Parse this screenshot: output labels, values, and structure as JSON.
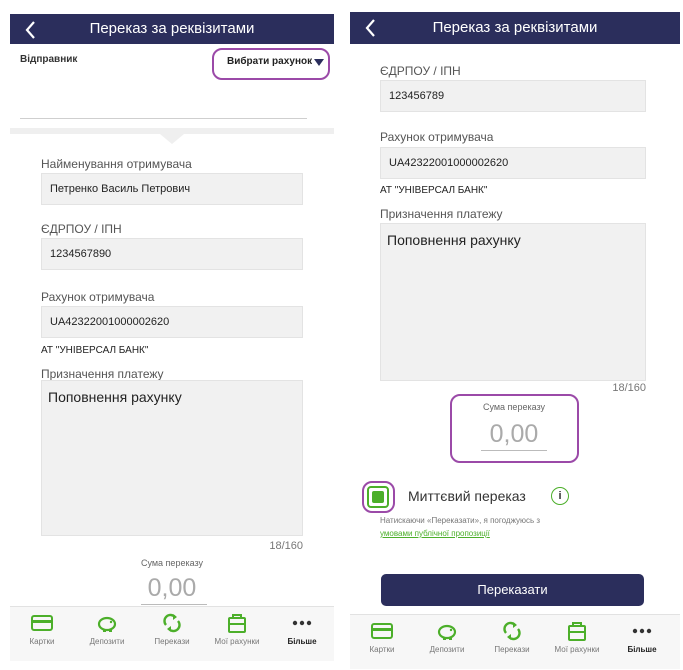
{
  "colors": {
    "navbar": "#2b2e5c",
    "accent": "#4caf2a",
    "highlight": "#9b4aa8",
    "field_bg": "#f1f1f1"
  },
  "left": {
    "nav": {
      "title": "Переказ за реквізитами",
      "back_icon": "chevron-left-icon"
    },
    "sender_label": "Відправник",
    "choose_account": "Вибрати рахунок",
    "recipient_name_label": "Найменування отримувача",
    "recipient_name_value": "Петренко Василь Петрович",
    "edrpou_label": "ЄДРПОУ / ІПН",
    "edrpou_value": "1234567890",
    "account_label": "Рахунок отримувача",
    "account_value": "UA42322001000002620",
    "bank_name": "АТ \"УНІВЕРСАЛ БАНК\"",
    "purpose_label": "Призначення платежу",
    "purpose_value": "Поповнення рахунку",
    "counter": "18/160",
    "amount_label": "Сума переказу",
    "amount_value": "0,00"
  },
  "right": {
    "nav": {
      "title": "Переказ за реквізитами",
      "back_icon": "chevron-left-icon"
    },
    "edrpou_label": "ЄДРПОУ / ІПН",
    "edrpou_value": "123456789",
    "account_label": "Рахунок отримувача",
    "account_value": "UA42322001000002620",
    "bank_name": "АТ \"УНІВЕРСАЛ БАНК\"",
    "purpose_label": "Призначення платежу",
    "purpose_value": "Поповнення рахунку",
    "counter": "18/160",
    "amount_label": "Сума переказу",
    "amount_value": "0,00",
    "instant_label": "Миттєвий переказ",
    "instant_checked": true,
    "consent_text": "Натискаючи «Переказати», я погоджуюсь з",
    "consent_link": "умовами публічної пропозиції",
    "transfer_button": "Переказати"
  },
  "tabbar": {
    "items": [
      {
        "label": "Картки",
        "icon": "card-icon"
      },
      {
        "label": "Депозити",
        "icon": "piggy-bank-icon"
      },
      {
        "label": "Перекази",
        "icon": "transfer-icon"
      },
      {
        "label": "Мої рахунки",
        "icon": "wallet-icon"
      },
      {
        "label": "Більше",
        "icon": "more-icon",
        "active": true
      }
    ]
  }
}
